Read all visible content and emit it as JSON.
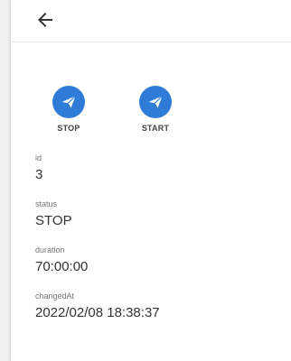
{
  "icons": {
    "back": "arrow-left-icon",
    "action": "send-icon"
  },
  "colors": {
    "accent": "#2f7bd8",
    "background": "#f1f1f1"
  },
  "actions": [
    {
      "label": "STOP"
    },
    {
      "label": "START"
    }
  ],
  "fields": [
    {
      "label": "id",
      "value": "3"
    },
    {
      "label": "status",
      "value": "STOP"
    },
    {
      "label": "duration",
      "value": "70:00:00"
    },
    {
      "label": "changedAt",
      "value": "2022/02/08 18:38:37"
    }
  ]
}
